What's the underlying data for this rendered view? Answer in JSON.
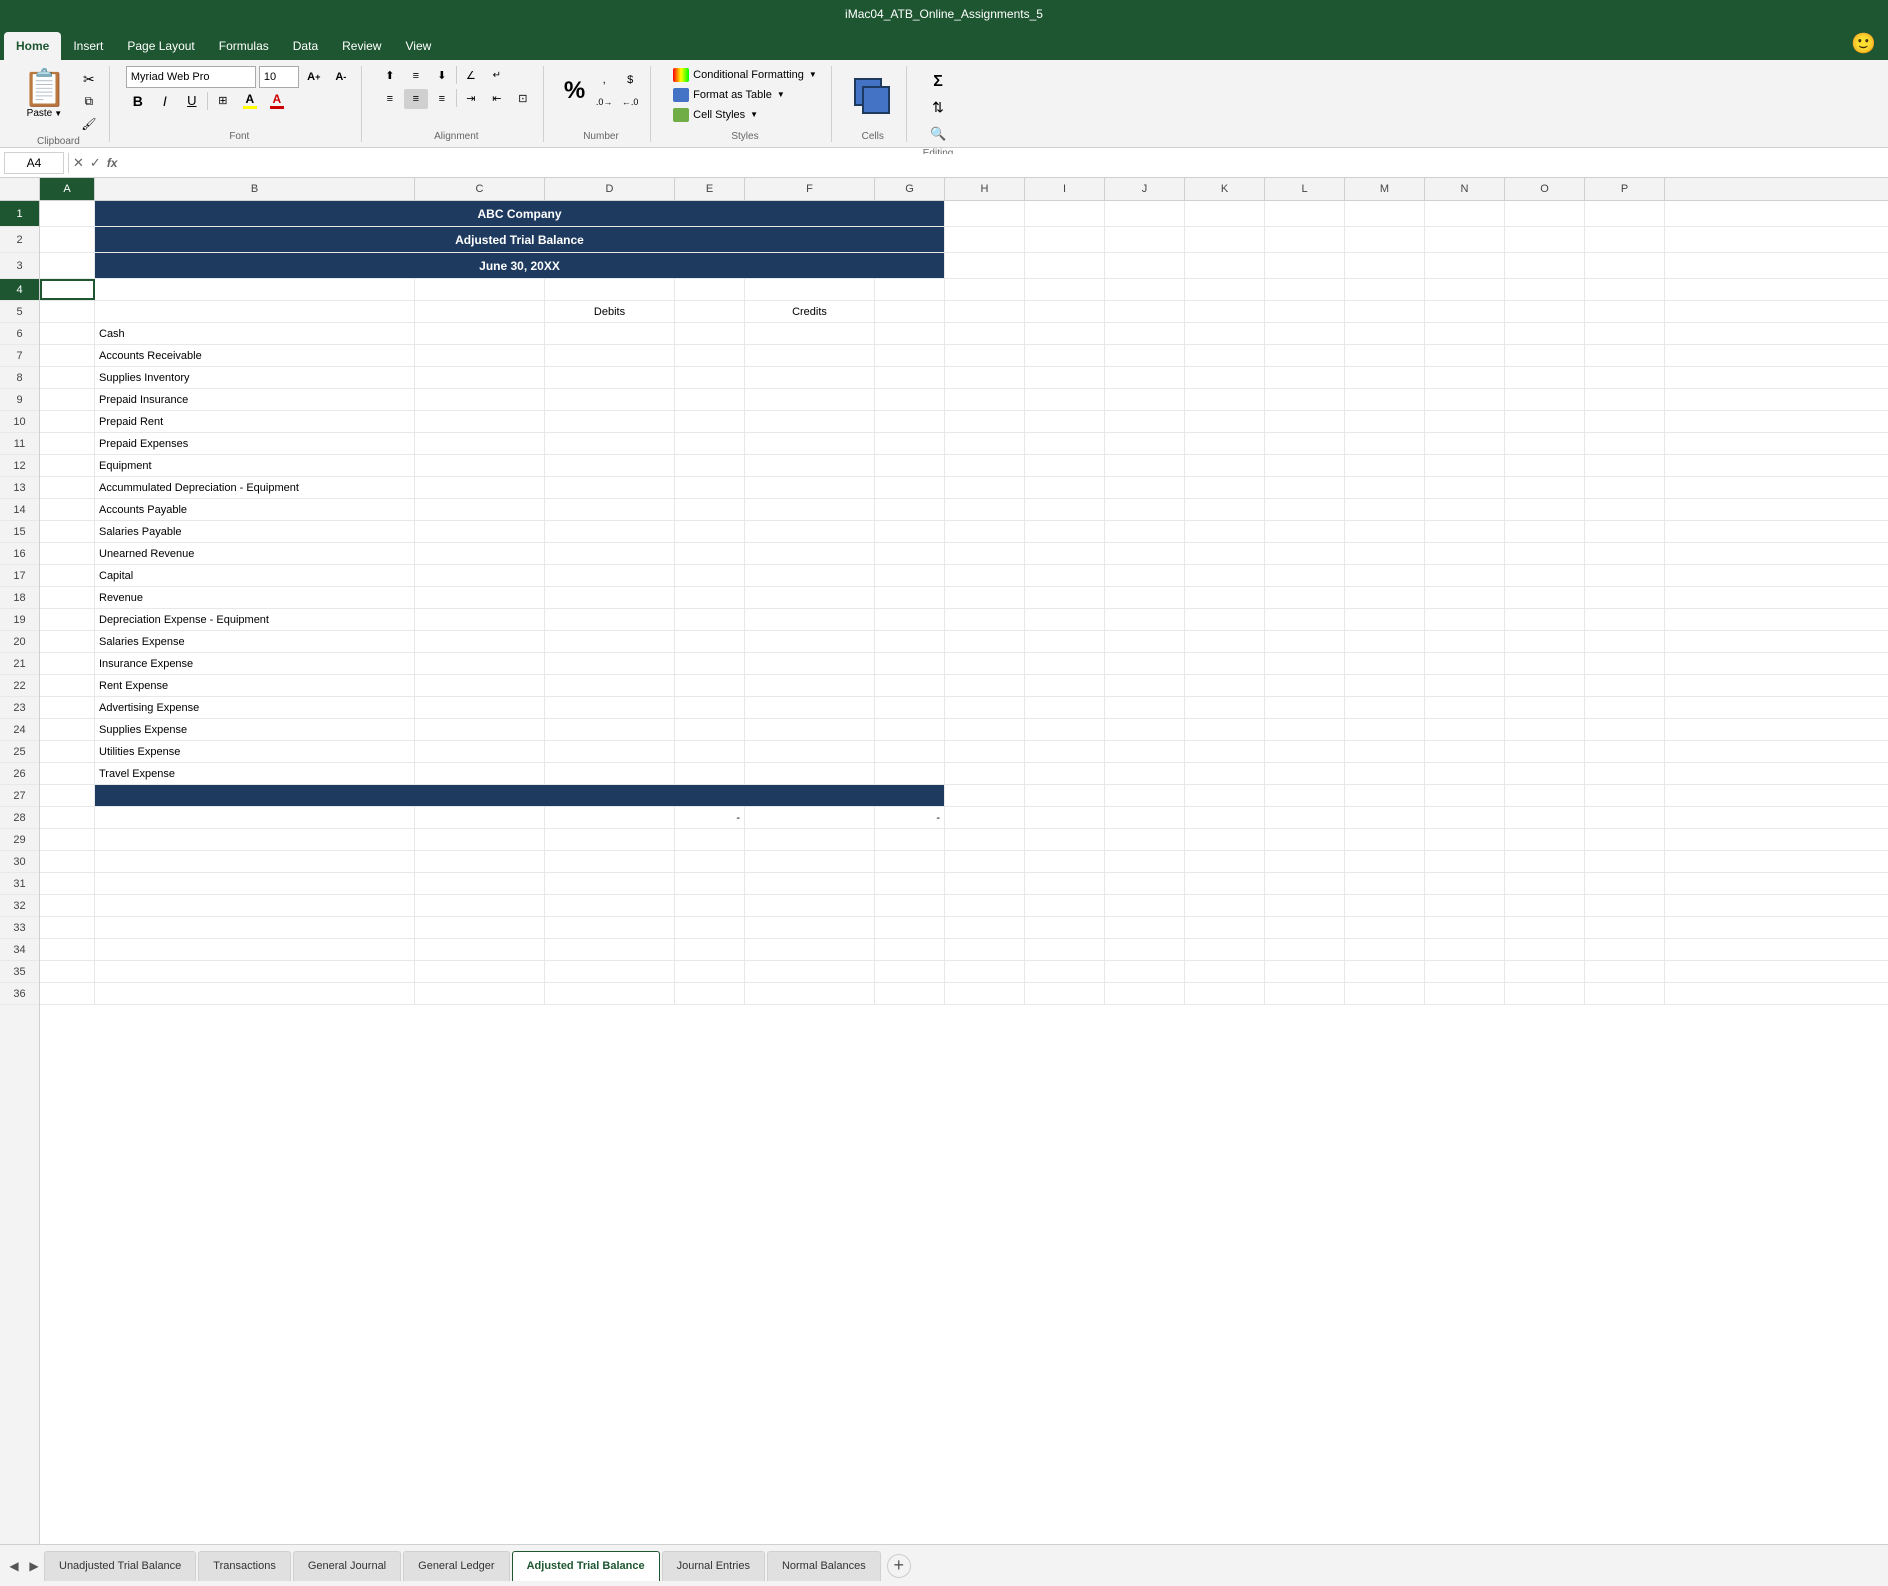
{
  "titleBar": {
    "text": "iMac04_ATB_Online_Assignments_5"
  },
  "ribbon": {
    "tabs": [
      {
        "label": "Home",
        "active": true
      },
      {
        "label": "Insert",
        "active": false
      },
      {
        "label": "Page Layout",
        "active": false
      },
      {
        "label": "Formulas",
        "active": false
      },
      {
        "label": "Data",
        "active": false
      },
      {
        "label": "Review",
        "active": false
      },
      {
        "label": "View",
        "active": false
      }
    ],
    "clipboard": {
      "label": "Clipboard",
      "paste": "Paste",
      "cut": "✂",
      "copy": "⧉",
      "formatPainter": "🖌"
    },
    "font": {
      "label": "Font",
      "name": "Myriad Web Pro",
      "size": "10",
      "bold": "B",
      "italic": "I",
      "underline": "U",
      "increaseFont": "A↑",
      "decreaseFont": "A↓",
      "borders": "⊞",
      "fillColor": "A",
      "fontColor": "A"
    },
    "alignment": {
      "label": "Alignment",
      "alignTop": "⬆",
      "alignMiddle": "☰",
      "alignBottom": "⬇",
      "alignLeft": "≡",
      "alignCenter": "≡",
      "alignRight": "≡",
      "wrapText": "↵",
      "mergeCenter": "⊡",
      "indent": "⇥",
      "outdent": "⇤",
      "orientation": "∠"
    },
    "number": {
      "label": "Number",
      "format": "%",
      "comma": ",",
      "currency": "$",
      "increaseDecimal": ".0→",
      "decreaseDecimal": "←.0"
    },
    "styles": {
      "label": "Styles",
      "conditionalFormatting": "Conditional Formatting",
      "formatAsTable": "Format as Table",
      "cellStyles": "Cell Styles"
    },
    "cells": {
      "label": "Cells",
      "icon": "cells"
    },
    "editing": {
      "label": "Editing",
      "icon": "✎",
      "sumIcon": "Σ",
      "sortFilter": "⇅",
      "findSelect": "🔍"
    }
  },
  "formulaBar": {
    "cellRef": "A4",
    "cancelIcon": "✕",
    "confirmIcon": "✓",
    "functionIcon": "fx",
    "formula": ""
  },
  "columns": [
    "A",
    "B",
    "C",
    "D",
    "E",
    "F",
    "G",
    "H",
    "I",
    "J",
    "K",
    "L",
    "M",
    "N",
    "O",
    "P"
  ],
  "rows": [
    {
      "num": 1,
      "data": {
        "b_c_d_e_f_g": "ABC Company",
        "merged": true,
        "style": "header"
      }
    },
    {
      "num": 2,
      "data": {
        "b_c_d_e_f_g": "Adjusted Trial Balance",
        "merged": true,
        "style": "header"
      }
    },
    {
      "num": 3,
      "data": {
        "b_c_d_e_f_g": "June 30, 20XX",
        "merged": true,
        "style": "header"
      }
    },
    {
      "num": 4,
      "data": {},
      "selected": true
    },
    {
      "num": 5,
      "data": {
        "d": "Debits",
        "f": "Credits"
      }
    },
    {
      "num": 6,
      "data": {
        "b": "Cash"
      }
    },
    {
      "num": 7,
      "data": {
        "b": "Accounts Receivable"
      }
    },
    {
      "num": 8,
      "data": {
        "b": "Supplies Inventory"
      }
    },
    {
      "num": 9,
      "data": {
        "b": "Prepaid Insurance"
      }
    },
    {
      "num": 10,
      "data": {
        "b": "Prepaid Rent"
      }
    },
    {
      "num": 11,
      "data": {
        "b": "Prepaid Expenses"
      }
    },
    {
      "num": 12,
      "data": {
        "b": "Equipment"
      }
    },
    {
      "num": 13,
      "data": {
        "b": "Accummulated Depreciation - Equipment"
      }
    },
    {
      "num": 14,
      "data": {
        "b": "Accounts Payable"
      }
    },
    {
      "num": 15,
      "data": {
        "b": "Salaries Payable"
      }
    },
    {
      "num": 16,
      "data": {
        "b": "Unearned Revenue"
      }
    },
    {
      "num": 17,
      "data": {
        "b": "Capital"
      }
    },
    {
      "num": 18,
      "data": {
        "b": "Revenue"
      }
    },
    {
      "num": 19,
      "data": {
        "b": "Depreciation Expense - Equipment"
      }
    },
    {
      "num": 20,
      "data": {
        "b": "Salaries Expense"
      }
    },
    {
      "num": 21,
      "data": {
        "b": "Insurance Expense"
      }
    },
    {
      "num": 22,
      "data": {
        "b": "Rent Expense"
      }
    },
    {
      "num": 23,
      "data": {
        "b": "Advertising Expense"
      }
    },
    {
      "num": 24,
      "data": {
        "b": "Supplies Expense"
      }
    },
    {
      "num": 25,
      "data": {
        "b": "Utilities Expense"
      }
    },
    {
      "num": 26,
      "data": {
        "b": "Travel Expense"
      }
    },
    {
      "num": 27,
      "data": {
        "style": "dark-row"
      }
    },
    {
      "num": 28,
      "data": {
        "e": "-",
        "g": "-"
      }
    },
    {
      "num": 29,
      "data": {}
    },
    {
      "num": 30,
      "data": {}
    },
    {
      "num": 31,
      "data": {}
    },
    {
      "num": 32,
      "data": {}
    },
    {
      "num": 33,
      "data": {}
    },
    {
      "num": 34,
      "data": {}
    },
    {
      "num": 35,
      "data": {}
    },
    {
      "num": 36,
      "data": {}
    }
  ],
  "sheetTabs": [
    {
      "label": "Unadjusted Trial Balance",
      "active": false
    },
    {
      "label": "Transactions",
      "active": false
    },
    {
      "label": "General Journal",
      "active": false
    },
    {
      "label": "General Ledger",
      "active": false
    },
    {
      "label": "Adjusted Trial Balance",
      "active": true
    },
    {
      "label": "Journal Entries",
      "active": false
    },
    {
      "label": "Normal Balances",
      "active": false
    }
  ],
  "colors": {
    "headerBg": "#1e3a5f",
    "headerText": "#ffffff",
    "activeTab": "#1e5631",
    "ribbonBg": "#1e5631"
  }
}
